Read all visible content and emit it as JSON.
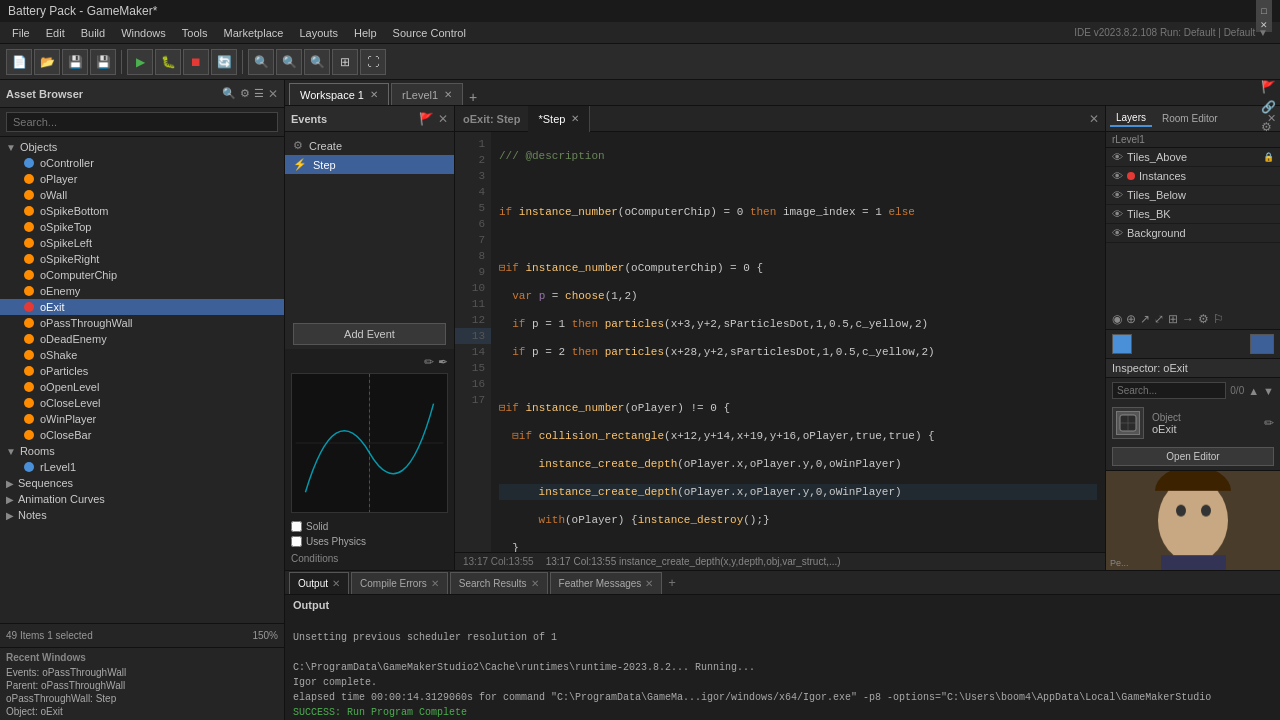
{
  "titlebar": {
    "title": "Battery Pack - GameMaker*",
    "controls": [
      "—",
      "□",
      "✕"
    ]
  },
  "menubar": {
    "items": [
      "File",
      "Edit",
      "Build",
      "Windows",
      "Tools",
      "Marketplace",
      "Layouts",
      "Help",
      "Source Control"
    ]
  },
  "ide_info": "IDE v2023.8.2.108  Run: Default | Default ▼",
  "asset_browser": {
    "title": "Asset Browser",
    "search_placeholder": "Search...",
    "objects_group": "Objects",
    "objects": [
      {
        "name": "oController",
        "color": "blue"
      },
      {
        "name": "oPlayer",
        "color": "orange"
      },
      {
        "name": "oWall",
        "color": "orange"
      },
      {
        "name": "oSpikeBottom",
        "color": "orange"
      },
      {
        "name": "oSpikeTop",
        "color": "orange"
      },
      {
        "name": "oSpikeLeft",
        "color": "orange"
      },
      {
        "name": "oSpikeRight",
        "color": "orange"
      },
      {
        "name": "oComputerChip",
        "color": "orange"
      },
      {
        "name": "oEnemy",
        "color": "orange"
      },
      {
        "name": "oExit",
        "color": "red",
        "selected": true
      },
      {
        "name": "oPassThroughWall",
        "color": "orange"
      },
      {
        "name": "oDeadEnemy",
        "color": "orange"
      },
      {
        "name": "oShake",
        "color": "orange"
      },
      {
        "name": "oParticles",
        "color": "orange"
      },
      {
        "name": "oOpenLevel",
        "color": "orange"
      },
      {
        "name": "oCloseLevel",
        "color": "orange"
      },
      {
        "name": "oWinPlayer",
        "color": "orange"
      },
      {
        "name": "oCloseBar",
        "color": "orange"
      }
    ],
    "rooms_group": "Rooms",
    "rooms": [
      {
        "name": "rLevel1",
        "color": "blue"
      }
    ],
    "sequences_group": "Sequences",
    "animation_curves": "Animation Curves",
    "notes": "Notes",
    "footer": {
      "count": "49 Items  1 selected",
      "zoom": "150%"
    }
  },
  "recent_windows": {
    "label": "Recent Windows",
    "items": [
      "Events: oPassThroughWall",
      "Parent: oPassThroughWall",
      "oPassThroughWall: Step",
      "Object: oExit"
    ]
  },
  "tabs": {
    "workspace": "Workspace 1",
    "r_level1": "rLevel1",
    "buttons": [
      "+"
    ]
  },
  "events_panel": {
    "title": "Events",
    "items": [
      {
        "name": "Create",
        "icon": "⚙"
      },
      {
        "name": "Step",
        "icon": "⚡",
        "active": true
      }
    ],
    "add_event_label": "Add Event"
  },
  "object_preview": {
    "tools": [
      "✏",
      "✒"
    ],
    "properties": {
      "solid": "Solid",
      "uses_physics": "Uses Physics",
      "conditions": "Conditions"
    }
  },
  "code_editor": {
    "title": "oExit: Step",
    "tabs": [
      "*Step"
    ],
    "lines": [
      {
        "num": 1,
        "text": "/// @description",
        "type": "comment"
      },
      {
        "num": 2,
        "text": "",
        "type": "normal"
      },
      {
        "num": 3,
        "text": "if instance_number(oComputerChip) = 0 then image_index = 1 else",
        "type": "code"
      },
      {
        "num": 4,
        "text": "",
        "type": "normal"
      },
      {
        "num": 5,
        "text": "if instance_number(oComputerChip) = 0 {",
        "type": "code"
      },
      {
        "num": 6,
        "text": "    var p = choose(1,2)",
        "type": "code"
      },
      {
        "num": 7,
        "text": "    if p = 1 then particles(x+3,y+2,sParticlesDot,1,0.5,c_yellow,2)",
        "type": "code"
      },
      {
        "num": 8,
        "text": "    if p = 2 then particles(x+28,y+2,sParticlesDot,1,0.5,c_yellow,2)",
        "type": "code"
      },
      {
        "num": 9,
        "text": "",
        "type": "normal"
      },
      {
        "num": 10,
        "text": "if instance_number(oPlayer) != 0 {",
        "type": "code"
      },
      {
        "num": 11,
        "text": "    collision_rectangle(x+12,y+14,x+19,y+16,oPlayer,true,true) {",
        "type": "code"
      },
      {
        "num": 12,
        "text": "        instance_create_depth(oPlayer.x,oPlayer.y,0,oWinPlayer)",
        "type": "code"
      },
      {
        "num": 13,
        "text": "        instance_create_depth(oPlayer.x,oPlayer.y,0,oWinPlayer)",
        "type": "code"
      },
      {
        "num": 14,
        "text": "        with(oPlayer) {instance_destroy();}",
        "type": "code"
      },
      {
        "num": 15,
        "text": "    }",
        "type": "code"
      },
      {
        "num": 16,
        "text": "}",
        "type": "code"
      },
      {
        "num": 17,
        "text": "",
        "type": "normal"
      }
    ],
    "status": "13:17 Col:13:55  instance_create_depth(x,y,depth,obj,var_struct,...)"
  },
  "output_panel": {
    "tabs": [
      "Output",
      "Compile Errors",
      "Search Results",
      "Feather Messages"
    ],
    "active_tab": "Output",
    "label": "Output",
    "lines": [
      {
        "text": "",
        "type": "normal"
      },
      {
        "text": "Unsetting previous scheduler resolution of 1",
        "type": "normal"
      },
      {
        "text": "",
        "type": "normal"
      },
      {
        "text": "C:\\ProgramData\\GameMakerStudio2\\Cache\\runtimes\\runtime-2023.8.2...  Running...",
        "type": "normal"
      },
      {
        "text": "Igor complete.",
        "type": "normal"
      },
      {
        "text": "elapsed time 00:00:14.3129060s for command \"C:\\ProgramData\\GameMa...igor/windows/x64/Igor.exe\" -p8 -options=\"C:\\Users\\boom4\\AppData\\Local\\GameMakerStudio",
        "type": "normal"
      },
      {
        "text": "SUCCESS: Run Program Complete",
        "type": "success"
      }
    ]
  },
  "layers_panel": {
    "title": "Layers",
    "breadcrumb": "rLevel1",
    "tabs": [
      "Layers",
      "Room Editor"
    ],
    "layers": [
      {
        "name": "Tiles_Above",
        "visible": true,
        "locked": false
      },
      {
        "name": "Instances",
        "visible": true,
        "locked": false
      },
      {
        "name": "Tiles_Below",
        "visible": true,
        "locked": false
      },
      {
        "name": "Tiles_BK",
        "visible": true,
        "locked": false
      },
      {
        "name": "Background",
        "visible": true,
        "locked": false
      }
    ]
  },
  "inspector": {
    "title": "Inspector: oExit",
    "search_placeholder": "Search...",
    "count": "0/0",
    "type": "Object",
    "name": "oExit",
    "open_editor_label": "Open Editor"
  },
  "inspector_toolbar": {
    "icons": [
      "◉",
      "⊕",
      "↗",
      "⤢",
      "⊞",
      "→",
      "⚙",
      "⚐"
    ]
  },
  "colors": {
    "accent": "#4a90d9",
    "background_dark": "#1a1a1a",
    "background_mid": "#252525",
    "background_light": "#2b2b2b",
    "selected": "#3d6099",
    "success": "#4caf50"
  }
}
